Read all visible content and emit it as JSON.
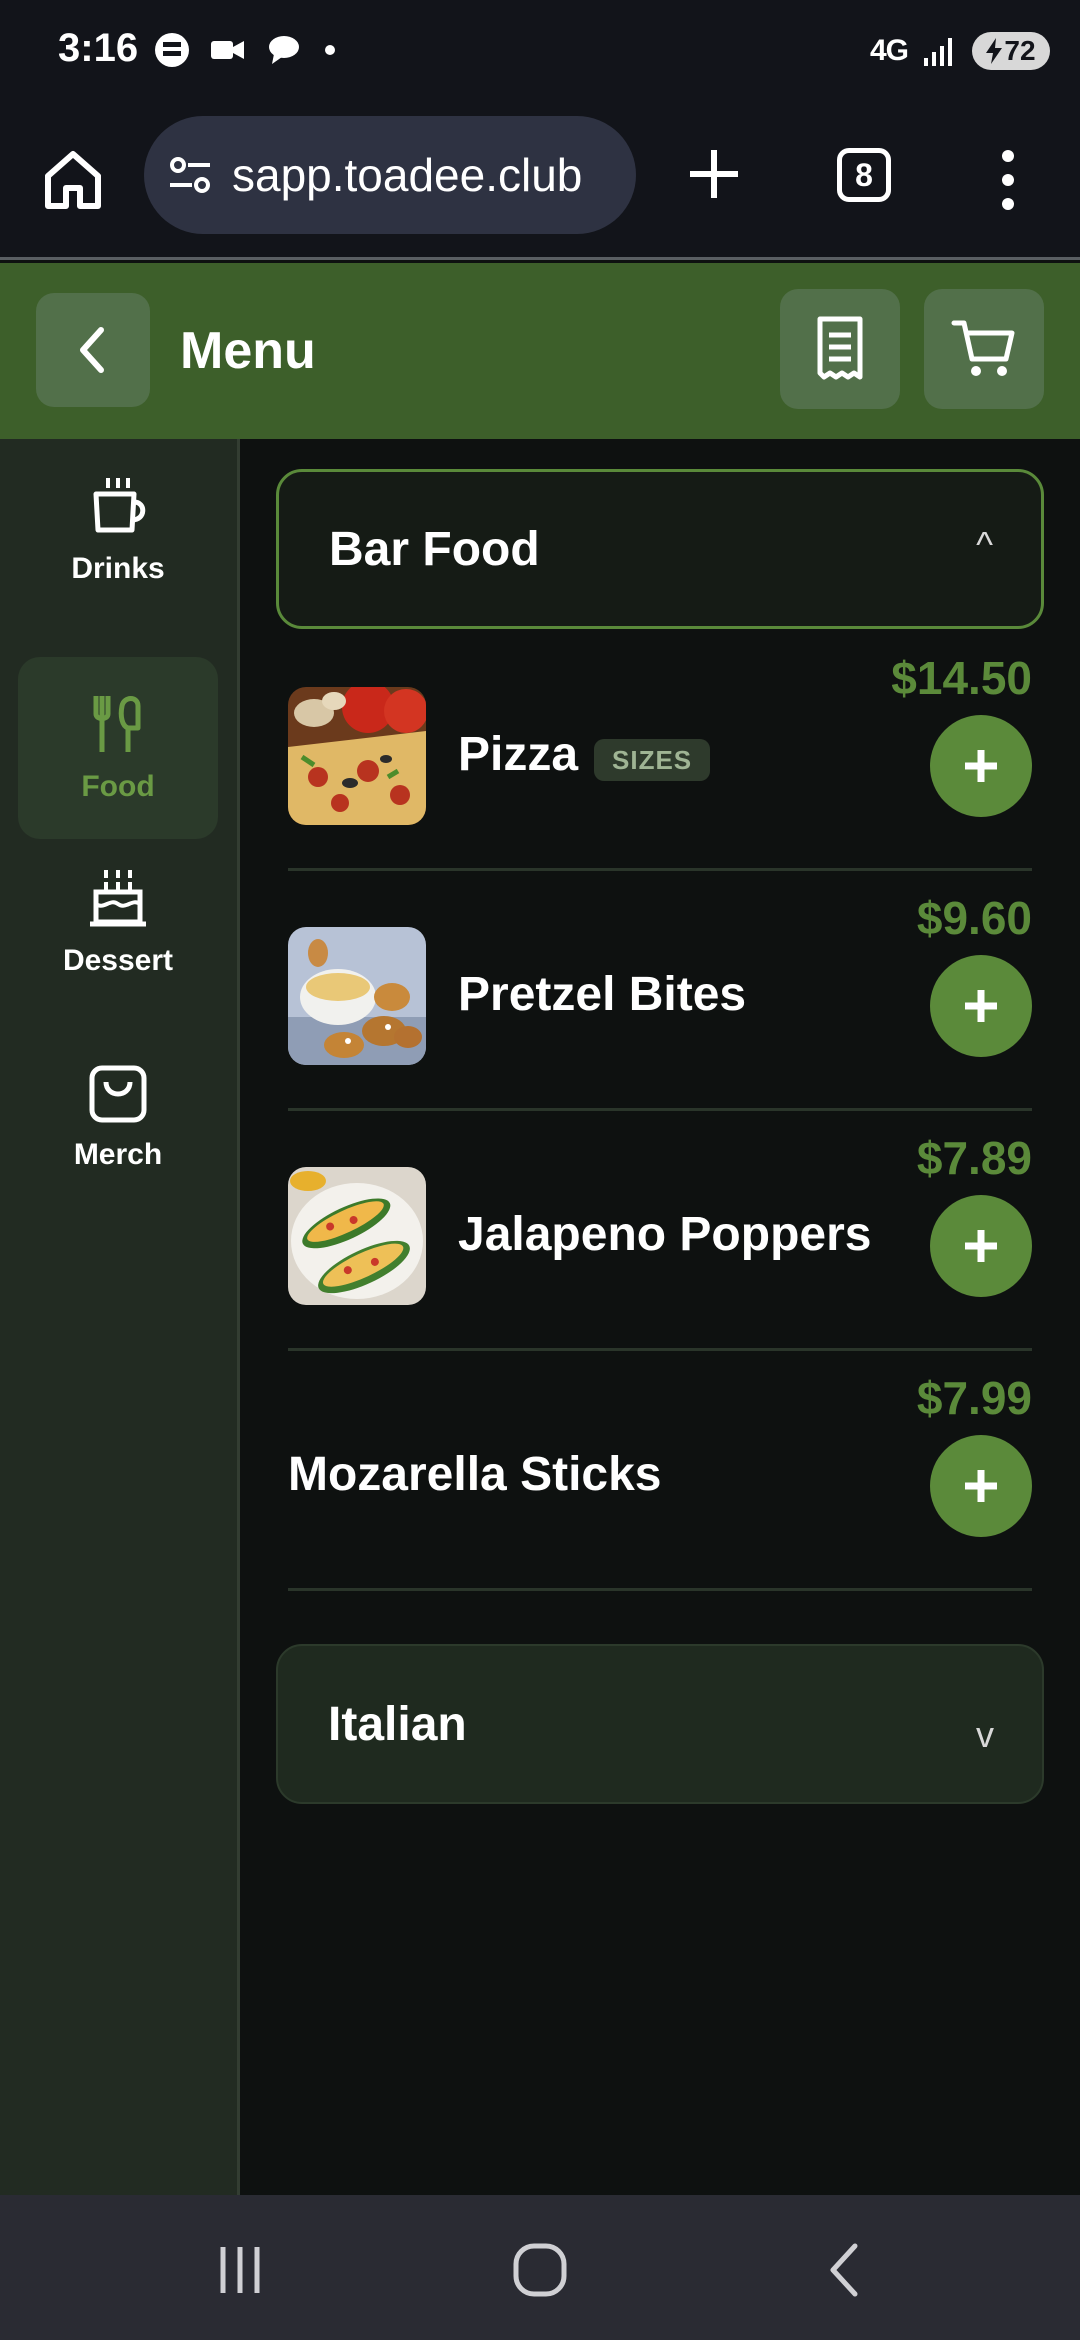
{
  "status_bar": {
    "time": "3:16",
    "network": "4G",
    "battery": "72"
  },
  "browser": {
    "url": "sapp.toadee.club",
    "tab_count": "8"
  },
  "header": {
    "title": "Menu"
  },
  "sidebar": {
    "categories": [
      {
        "label": "Drinks",
        "icon": "coffee-cup-icon",
        "active": false
      },
      {
        "label": "Food",
        "icon": "utensils-icon",
        "active": true
      },
      {
        "label": "Dessert",
        "icon": "cake-icon",
        "active": false
      },
      {
        "label": "Merch",
        "icon": "shopping-bag-icon",
        "active": false
      }
    ]
  },
  "sections": [
    {
      "title": "Bar Food",
      "expanded": true,
      "chevron": "^",
      "items": [
        {
          "name": "Pizza",
          "badge": "SIZES",
          "price": "$14.50",
          "has_image": true
        },
        {
          "name": "Pretzel Bites",
          "price": "$9.60",
          "has_image": true
        },
        {
          "name": "Jalapeno Poppers",
          "price": "$7.89",
          "has_image": true
        },
        {
          "name": "Mozarella Sticks",
          "price": "$7.99",
          "has_image": false
        }
      ]
    },
    {
      "title": "Italian",
      "expanded": false,
      "chevron": "v"
    }
  ],
  "colors": {
    "accent": "#5b8a3a",
    "header_bg": "#3d5f2a",
    "sidebar_bg": "#222b22",
    "main_bg": "#0e1110"
  }
}
